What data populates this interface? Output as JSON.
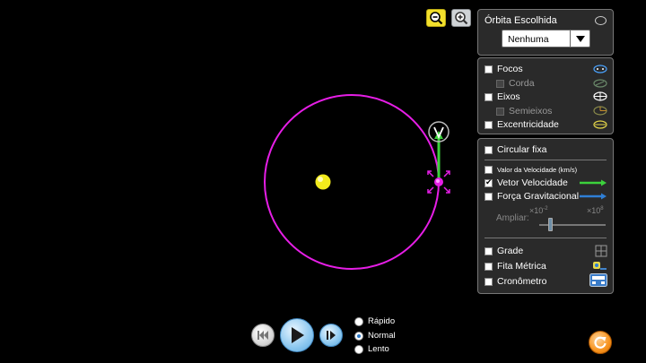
{
  "orbit": {
    "title": "Órbita Escolhida",
    "selected": "Nenhuma"
  },
  "display_options": {
    "focos": "Focos",
    "corda": "Corda",
    "eixos": "Eixos",
    "semieixos": "Semieixos",
    "excentricidade": "Excentricidade"
  },
  "vector_options": {
    "circular_fixa": "Circular fixa",
    "valor_velocidade": "Valor da Velocidade (km/s)",
    "vetor_velocidade": "Vetor Velocidade",
    "forca_gravitacional": "Força Gravitacional",
    "vetor_velocidade_checked": true,
    "ampliar_label": "Ampliar:",
    "scale_min_base": "×10",
    "scale_min_exp": "-2",
    "scale_max_base": "×10",
    "scale_max_exp": "8"
  },
  "tools": {
    "grade": "Grade",
    "fita_metrica": "Fita Métrica",
    "cronometro": "Cronômetro"
  },
  "playback": {
    "speeds": [
      "Rápido",
      "Normal",
      "Lento"
    ],
    "selected_speed": "Normal"
  },
  "colors": {
    "orbit": "#e61ee6",
    "sun": "#f2ea1c",
    "velocity_vector": "#3cd23c",
    "gravity_vector": "#2f7fd6",
    "planet": "#e61ee6"
  },
  "icons": {
    "zoom_out": "zoom-out-icon",
    "zoom_in": "zoom-in-icon",
    "rewind": "rewind-icon",
    "play": "play-icon",
    "step": "step-forward-icon",
    "reset": "reset-icon"
  }
}
